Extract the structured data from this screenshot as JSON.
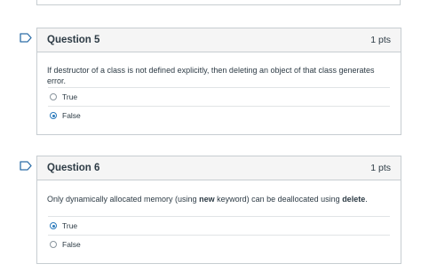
{
  "questions": [
    {
      "title": "Question 5",
      "points": "1 pts",
      "text_parts": [
        "If destructor of a class is not defined explicitly, then deleting an object of that class generates error."
      ],
      "answers": [
        {
          "label": "True",
          "selected": false
        },
        {
          "label": "False",
          "selected": true
        }
      ]
    },
    {
      "title": "Question 6",
      "points": "1 pts",
      "text_pre": "Only dynamically allocated memory (using ",
      "text_kw1": "new",
      "text_mid": " keyword) can be deallocated using ",
      "text_kw2": "delete",
      "text_post": ".",
      "answers": [
        {
          "label": "True",
          "selected": true
        },
        {
          "label": "False",
          "selected": false
        }
      ]
    }
  ],
  "colors": {
    "accent": "#2b7abc",
    "flag": "#2d6ea8",
    "border": "#c7cdd1",
    "header_bg": "#f5f5f5"
  },
  "icons": {
    "flag": "bookmark-flag-icon",
    "radio": "radio-button-icon"
  }
}
